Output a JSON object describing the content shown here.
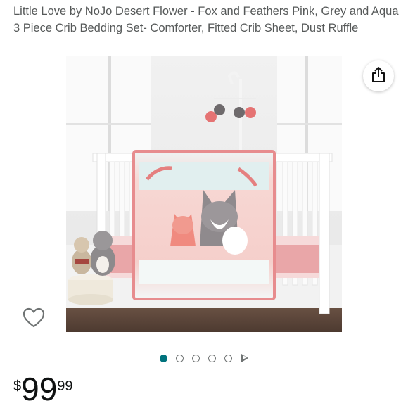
{
  "product": {
    "title": "Little Love by NoJo Desert Flower - Fox and Feathers Pink, Grey and Aqua 3 Piece Crib Bedding Set- Comforter, Fitted Crib Sheet, Dust Ruffle",
    "image_alt": "Crib with fox and feathers bedding set, mobile and plush toys"
  },
  "actions": {
    "share_icon": "share-icon",
    "wishlist_icon": "heart-outline-icon"
  },
  "carousel": {
    "total_images": 5,
    "active_index": 0,
    "active_color": "#00737d",
    "play_icon": "play-icon"
  },
  "price": {
    "symbol": "$",
    "whole": "99",
    "fraction": "99"
  }
}
